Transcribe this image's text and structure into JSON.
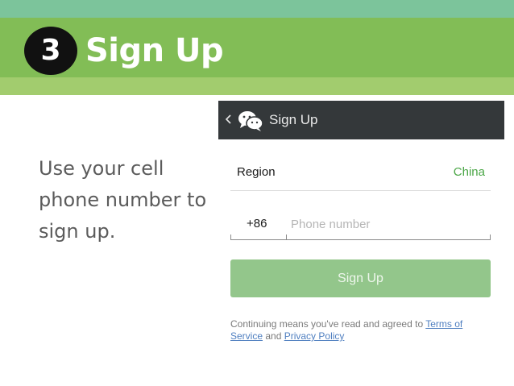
{
  "slide": {
    "step_number": "3",
    "title": "Sign Up",
    "caption": "Use your cell phone number to sign up.",
    "colors": {
      "band_top": "#7cc49b",
      "band_main": "#82bd56",
      "band_low": "#a2cc6e"
    }
  },
  "app": {
    "header_title": "Sign Up",
    "back_icon": "chevron-left-icon",
    "app_icon": "wechat-logo-icon"
  },
  "form": {
    "region_label": "Region",
    "region_value": "China",
    "country_code": "+86",
    "phone_placeholder": "Phone number",
    "phone_value": "",
    "submit_label": "Sign Up",
    "accent": "#4aa646"
  },
  "terms": {
    "prefix": "Continuing means you've read and agreed to ",
    "terms_link": "Terms of Service",
    "conjunction": " and ",
    "privacy_link": "Privacy Policy"
  }
}
